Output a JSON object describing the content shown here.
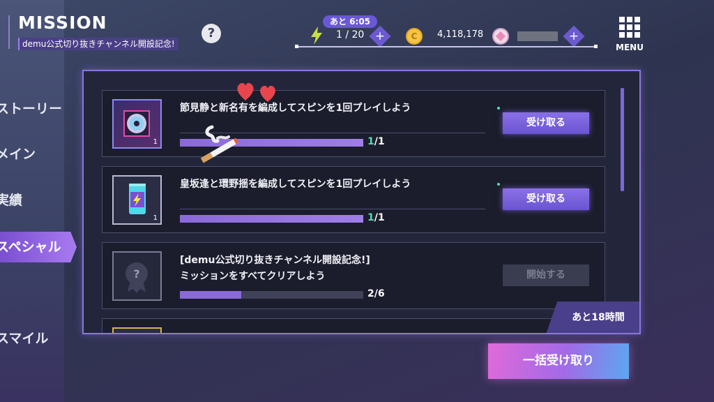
{
  "header": {
    "title": "MISSION",
    "subtitle": "demu公式切り抜きチャンネル開設記念!",
    "help_label": "?",
    "timer": "あと 6:05",
    "stamina": "1 / 20",
    "coins": "4,118,178",
    "coin_symbol": "C",
    "plus": "+",
    "menu_label": "MENU"
  },
  "sidebar": {
    "items": [
      {
        "label": "ストーリー"
      },
      {
        "label": "メイン"
      },
      {
        "label": "実績"
      },
      {
        "label": "スペシャル",
        "active": true
      },
      {
        "label": "スマイル"
      }
    ]
  },
  "missions": [
    {
      "icon": "cd-icon",
      "icon_count": "1",
      "title": "節見静と新名有を編成してスピンを1回プレイしよう",
      "progress_value": "1",
      "progress_total": "/1",
      "progress": 1.0,
      "button": "受け取る",
      "button_state": "claim"
    },
    {
      "icon": "energy-drink-icon",
      "icon_count": "1",
      "title": "皇坂逢と環野揺を編成してスピンを1回プレイしよう",
      "progress_value": "1",
      "progress_total": "/1",
      "progress": 1.0,
      "button": "受け取る",
      "button_state": "claim"
    },
    {
      "icon": "mystery-badge-icon",
      "icon_label": "?",
      "title_line1": "[demu公式切り抜きチャンネル開設記念!]",
      "title_line2": "ミッションをすべてクリアしよう",
      "progress_text": "2/6",
      "progress": 0.333,
      "button": "開始する",
      "button_state": "disabled"
    }
  ],
  "time_remaining": "あと18時間",
  "bulk_claim": "一括受け取り",
  "colors": {
    "accent": "#8a6ad8",
    "progress_done": "#4ee0b8",
    "panel_border": "#8a78d8"
  }
}
